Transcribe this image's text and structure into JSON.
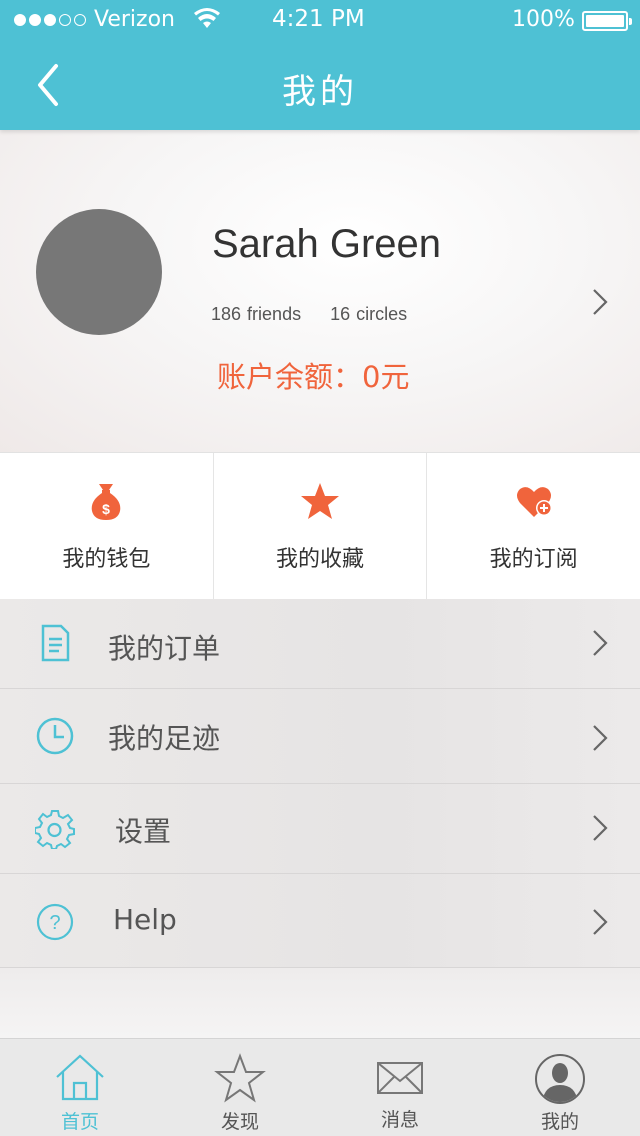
{
  "status_bar": {
    "carrier": "Verizon",
    "time": "4:21 PM",
    "battery": "100%"
  },
  "header": {
    "title": "我的"
  },
  "profile": {
    "name": "Sarah Green",
    "friends_count": "186",
    "friends_label": "friends",
    "circles_count": "16",
    "circles_label": "circles",
    "balance": "账户余额：0元"
  },
  "quick_actions": [
    {
      "label": "我的钱包",
      "icon": "money-bag-icon"
    },
    {
      "label": "我的收藏",
      "icon": "star-icon"
    },
    {
      "label": "我的订阅",
      "icon": "heart-plus-icon"
    }
  ],
  "menu": [
    {
      "label": "我的订单",
      "icon": "document-icon"
    },
    {
      "label": "我的足迹",
      "icon": "clock-icon"
    },
    {
      "label": "设置",
      "icon": "gear-icon"
    },
    {
      "label": "Help",
      "icon": "help-icon"
    }
  ],
  "tabbar": [
    {
      "label": "首页",
      "icon": "home-icon",
      "active": true
    },
    {
      "label": "发现",
      "icon": "star-outline-icon"
    },
    {
      "label": "消息",
      "icon": "envelope-icon"
    },
    {
      "label": "我的",
      "icon": "user-avatar-icon"
    }
  ],
  "colors": {
    "accent": "#4ec1d4",
    "highlight": "#f0643c",
    "avatar": "#777777"
  }
}
